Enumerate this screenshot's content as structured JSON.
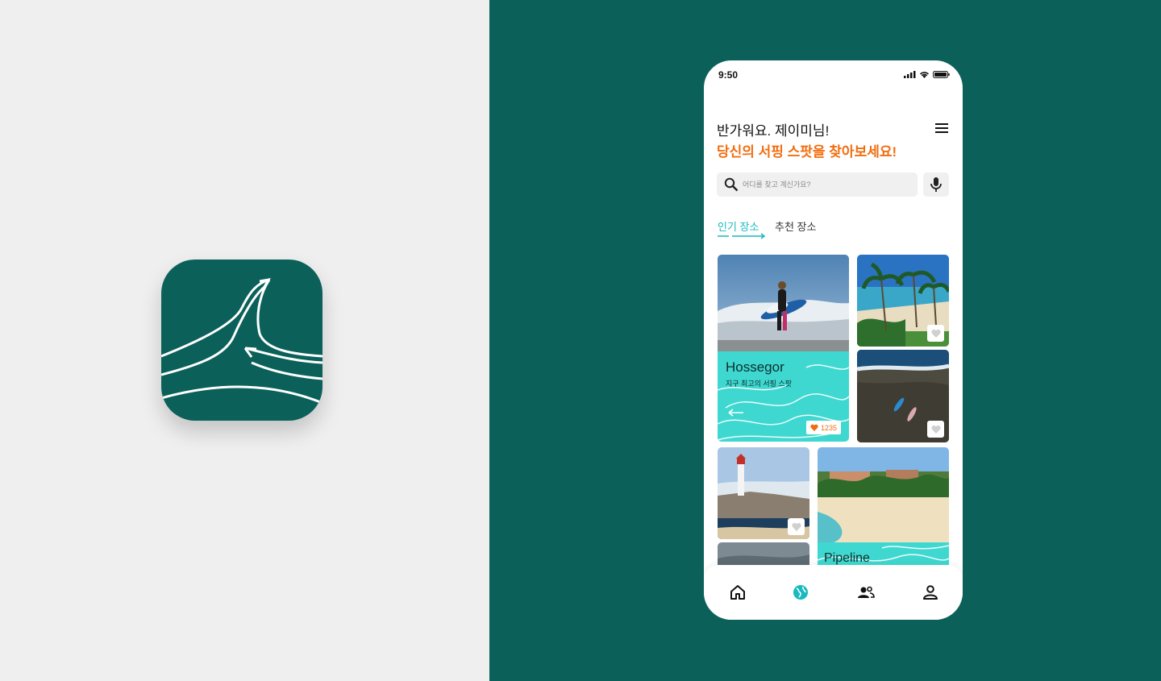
{
  "status_bar": {
    "time": "9:50"
  },
  "header": {
    "greeting": "반가워요. 제이미님!",
    "subtitle": "당신의 서핑 스팟을 찾아보세요!"
  },
  "search": {
    "placeholder": "어디를 찾고 계신가요?"
  },
  "tabs": [
    {
      "label": "인기 장소",
      "active": true
    },
    {
      "label": "추천 장소",
      "active": false
    }
  ],
  "cards": {
    "featured": {
      "title": "Hossegor",
      "subtitle": "지구 최고의 서핑 스팟",
      "likes": "1235"
    },
    "pipeline": {
      "title": "Pipeline"
    }
  },
  "icons": {
    "menu": "hamburger-icon",
    "search": "search-icon",
    "mic": "microphone-icon",
    "heart": "heart-icon",
    "home": "home-icon",
    "explore": "globe-icon",
    "community": "people-icon",
    "profile": "person-icon"
  },
  "colors": {
    "brand_green": "#0b615a",
    "accent_orange": "#f26d0f",
    "accent_teal": "#18b9c0",
    "card_cyan": "#3fd8d0"
  }
}
